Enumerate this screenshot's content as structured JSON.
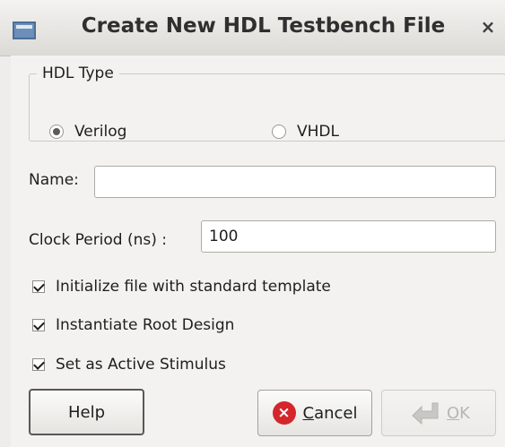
{
  "window": {
    "title": "Create New HDL Testbench File",
    "close_symbol": "×"
  },
  "hdl_type": {
    "legend": "HDL Type",
    "options": [
      {
        "label": "Verilog",
        "selected": true
      },
      {
        "label": "VHDL",
        "selected": false
      }
    ]
  },
  "name": {
    "label": "Name:",
    "value": ""
  },
  "clock": {
    "label": "Clock Period (ns) :",
    "value": "100"
  },
  "checkboxes": [
    {
      "label": "Initialize file with standard template",
      "checked": true
    },
    {
      "label": "Instantiate Root Design",
      "checked": true
    },
    {
      "label": "Set as Active Stimulus",
      "checked": true
    }
  ],
  "buttons": {
    "help": "Help",
    "cancel_mnemonic": "C",
    "cancel_rest": "ancel",
    "ok_mnemonic": "O",
    "ok_rest": "K",
    "cancel_icon": "×"
  },
  "colors": {
    "cancel_icon": "#d4262b"
  }
}
